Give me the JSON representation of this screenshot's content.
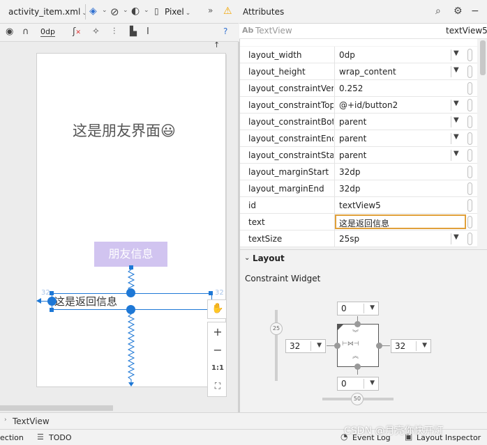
{
  "toolbar": {
    "file_name": "activity_item.xml",
    "device": "Pixel",
    "margin_value": "0dp",
    "overflow": "»"
  },
  "attributes": {
    "header_title": "Attributes",
    "view_type": "TextView",
    "view_id": "textView5",
    "view_badge": "Ab",
    "rows": [
      {
        "key": "layout_width",
        "value": "0dp",
        "dropdown": true
      },
      {
        "key": "layout_height",
        "value": "wrap_content",
        "dropdown": true
      },
      {
        "key": "layout_constraintVert...",
        "value": "0.252",
        "dropdown": false
      },
      {
        "key": "layout_constraintTop...",
        "value": "@+id/button2",
        "dropdown": true
      },
      {
        "key": "layout_constraintBot...",
        "value": "parent",
        "dropdown": true
      },
      {
        "key": "layout_constraintEnd...",
        "value": "parent",
        "dropdown": true
      },
      {
        "key": "layout_constraintStar...",
        "value": "parent",
        "dropdown": true
      },
      {
        "key": "layout_marginStart",
        "value": "32dp",
        "dropdown": false
      },
      {
        "key": "layout_marginEnd",
        "value": "32dp",
        "dropdown": false
      },
      {
        "key": "id",
        "value": "textView5",
        "dropdown": false
      },
      {
        "key": "text",
        "value": "这是返回信息",
        "dropdown": false,
        "editing": true
      },
      {
        "key": "textSize",
        "value": "25sp",
        "dropdown": true
      }
    ],
    "layout_section": "Layout",
    "constraint_widget_label": "Constraint Widget",
    "constraint": {
      "top": "0",
      "bottom": "0",
      "left": "32",
      "right": "32",
      "vertical_bias": "25",
      "horizontal_bias": "50"
    }
  },
  "preview": {
    "title_text": "这是朋友界面😃",
    "friend_button": "朋友信息",
    "selected_text": "这是返回信息",
    "margin_left": "32",
    "margin_right": "32",
    "zoom_ratio": "1:1"
  },
  "breadcrumb": {
    "item": "TextView"
  },
  "statusbar": {
    "left_fragment": "ection",
    "todo": "TODO",
    "event_log": "Event Log",
    "layout_inspector": "Layout Inspector",
    "watermark": "CSDN @月亮你快开灯"
  },
  "colors": {
    "selection_blue": "#1e78d6",
    "button_bg": "#d1c4f0",
    "edit_border": "#e0a03a",
    "warning": "#f2a500"
  },
  "icons": [
    "layers-icon",
    "orientation-icon",
    "theme-icon",
    "phone-icon",
    "warning-icon",
    "eye-icon",
    "magnet-off-icon",
    "clear-constraints-icon",
    "magic-wand-icon",
    "pack-icon",
    "align-icon",
    "guidelines-icon",
    "help-icon",
    "search-icon",
    "gear-icon",
    "pin-icon",
    "hand-icon",
    "zoom-in-icon",
    "zoom-out-icon",
    "fit-screen-icon"
  ]
}
